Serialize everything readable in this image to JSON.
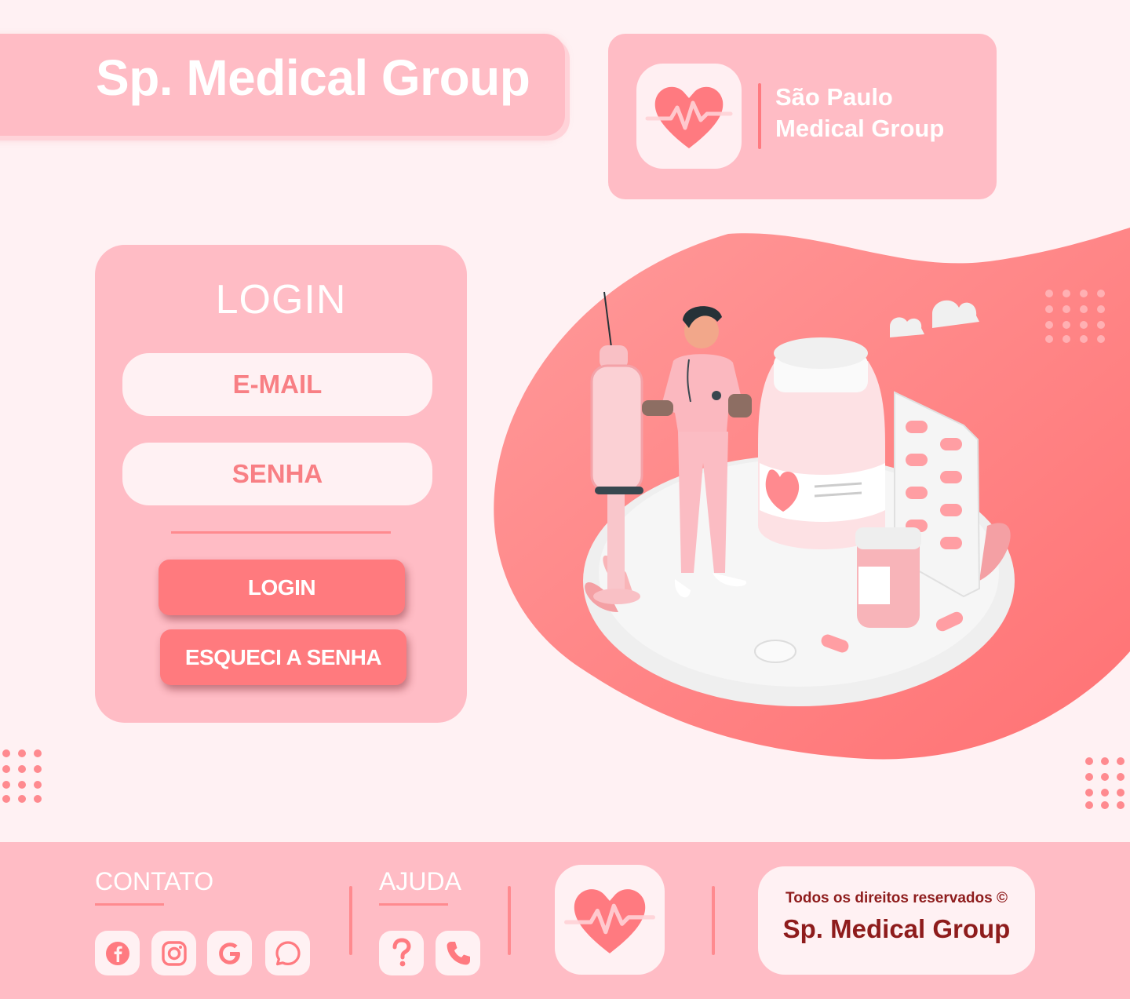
{
  "header": {
    "title": "Sp. Medical Group",
    "brand_line1": "São Paulo",
    "brand_line2": "Medical Group",
    "logo_icon": "heart-pulse-icon"
  },
  "login": {
    "title": "LOGIN",
    "email_placeholder": "E-MAIL",
    "password_placeholder": "SENHA",
    "login_button": "LOGIN",
    "forgot_button": "ESQUECI A SENHA"
  },
  "illustration": {
    "subject": "doctor-with-syringe-and-medicine-icon"
  },
  "footer": {
    "contact_heading": "CONTATO",
    "help_heading": "AJUDA",
    "contact_icons": [
      "facebook-icon",
      "instagram-icon",
      "google-icon",
      "whatsapp-icon"
    ],
    "help_icons": [
      "question-icon",
      "phone-icon"
    ],
    "rights": "Todos os direitos reservados ©",
    "company": "Sp. Medical Group"
  },
  "colors": {
    "background": "#fff1f3",
    "panel": "#ffbcc5",
    "accent": "#ff7a7e",
    "text_dark": "#8e1c1c"
  }
}
